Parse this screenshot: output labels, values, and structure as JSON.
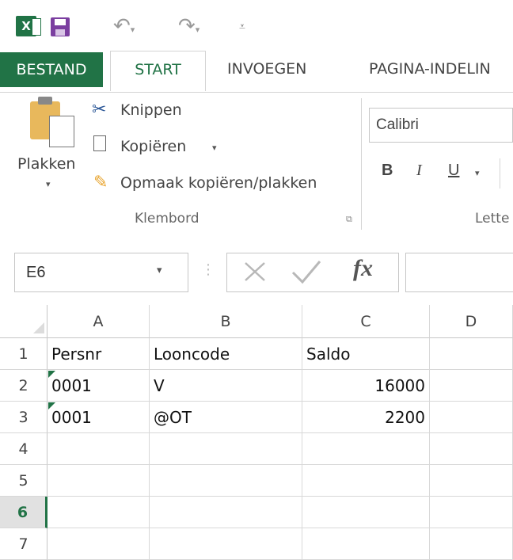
{
  "quick_access": {
    "app_icon": "excel-icon",
    "icons": [
      "save-icon",
      "undo-icon",
      "redo-icon",
      "customize-qat-icon"
    ]
  },
  "tabs": [
    {
      "label": "BESTAND"
    },
    {
      "label": "START"
    },
    {
      "label": "INVOEGEN"
    },
    {
      "label": "PAGINA-INDELIN"
    }
  ],
  "ribbon": {
    "clipboard": {
      "paste_label": "Plakken",
      "cut_label": "Knippen",
      "copy_label": "Kopiëren",
      "format_painter_label": "Opmaak kopiëren/plakken",
      "group_label": "Klembord"
    },
    "font": {
      "font_name": "Calibri",
      "bold": "B",
      "italic": "I",
      "underline": "U",
      "group_label": "Lette"
    }
  },
  "formula_bar": {
    "name_box": "E6",
    "fx_label": "fx",
    "formula": ""
  },
  "grid": {
    "columns": [
      "A",
      "B",
      "C",
      "D"
    ],
    "rows": [
      "1",
      "2",
      "3",
      "4",
      "5",
      "6",
      "7"
    ],
    "selected_row": "6",
    "cells": [
      [
        "Persnr",
        "Looncode",
        "Saldo",
        ""
      ],
      [
        "0001",
        "V",
        "16000",
        ""
      ],
      [
        "0001",
        "@OT",
        "2200",
        ""
      ],
      [
        "",
        "",
        "",
        ""
      ],
      [
        "",
        "",
        "",
        ""
      ],
      [
        "",
        "",
        "",
        ""
      ],
      [
        "",
        "",
        "",
        ""
      ]
    ]
  },
  "colors": {
    "accent": "#217346"
  }
}
